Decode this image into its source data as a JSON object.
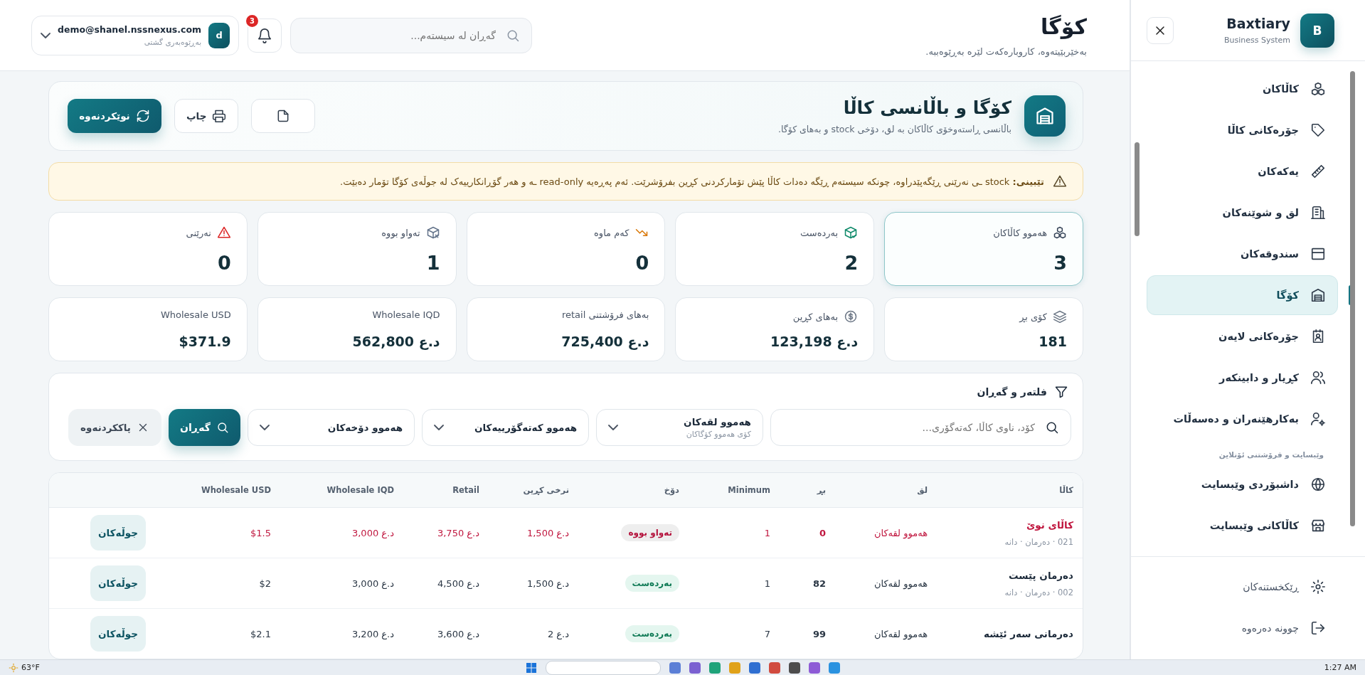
{
  "header": {
    "title": "کۆگا",
    "subtitle": "بەخێربێیتەوە، کاروبارەکەت لێرە بەڕێوەببە.",
    "search": {
      "placeholder": "گەڕان لە سیستەم..."
    },
    "notifications": {
      "count": "3"
    },
    "user": {
      "avatar": "d",
      "email": "demo@shanel.nssnexus.com",
      "role": "بەڕێوەبەری گشتی"
    }
  },
  "hero": {
    "title": "کۆگا و باڵانسی کاڵا",
    "description": "باڵانسی ڕاستەوخۆی کاڵاکان بە لق، دۆخی stock و بەهای کۆگا.",
    "buttons": [
      {
        "label": "چاپ",
        "kind": "print"
      },
      {
        "label": "نوێکردنەوە",
        "kind": "refresh"
      }
    ]
  },
  "alert": {
    "text": "**تێبینی:** stock ـی نەرێنی ڕێگەپێدراوە، چونکە سیستەم ڕێگە دەدات کاڵا پێش تۆمارکردنی کڕین بفرۆشرێت. ئەم پەڕەیە read-only ـە و هەر گۆڕانکارییەک لە جوڵەی کۆگا تۆمار دەبێت."
  },
  "stats": [
    {
      "label": "هەموو کاڵاکان",
      "value": "3",
      "kind": "all",
      "selected": true
    },
    {
      "label": "بەردەست",
      "value": "2",
      "kind": "available",
      "selected": false
    },
    {
      "label": "کەم ماوە",
      "value": "0",
      "kind": "low",
      "selected": false
    },
    {
      "label": "تەواو بووە",
      "value": "1",
      "kind": "out",
      "selected": false
    },
    {
      "label": "نەرێنی",
      "value": "0",
      "kind": "negative",
      "selected": false
    }
  ],
  "totals": [
    {
      "label": "کۆی بڕ",
      "value": "181",
      "kind": "quantity"
    },
    {
      "label": "بەهای کڕین",
      "value": "123,198 د.ع",
      "kind": "money"
    },
    {
      "label": "بەهای فرۆشتنی retail",
      "value": "725,400 د.ع",
      "kind": "plain"
    },
    {
      "label": "Wholesale IQD",
      "value": "562,800 د.ع",
      "kind": "plain"
    },
    {
      "label": "Wholesale USD",
      "value": "$371.9",
      "kind": "plain"
    }
  ],
  "filters": {
    "title": "فلتەر و گەڕان",
    "search": {
      "placeholder": "کۆد، ناوی کاڵا، کەتەگۆری..."
    },
    "selects": [
      {
        "value": "هەموو لقەکان",
        "hint": "کۆی هەموو کۆگاکان"
      },
      {
        "value": "هەموو کەتەگۆرییەکان"
      },
      {
        "value": "هەموو دۆخەکان"
      }
    ],
    "search_button": "گەڕان",
    "clear_button": "پاککردنەوە"
  },
  "table": {
    "columns": [
      "کاڵا",
      "لق",
      "بڕ",
      "Minimum",
      "دۆخ",
      "نرخی کڕین",
      "Retail",
      "Wholesale IQD",
      "Wholesale USD"
    ],
    "rows": [
      {
        "name": "کاڵای نوێ",
        "meta": "021 · دەرمان · دانە",
        "branch": "هەموو لقەکان",
        "qty": "0",
        "minimum": "1",
        "status": {
          "label": "تەواو بووە",
          "kind": "out"
        },
        "buy": "1,500 د.ع",
        "retail": "3,750 د.ع",
        "wholesale_iqd": "3,000 د.ع",
        "wholesale_usd": "$1.5",
        "action": "جوڵەکان"
      },
      {
        "name": "دەرمان پێست",
        "meta": "002 · دەرمان · دانە",
        "branch": "هەموو لقەکان",
        "qty": "82",
        "minimum": "1",
        "status": {
          "label": "بەردەست",
          "kind": "available"
        },
        "buy": "1,500 د.ع",
        "retail": "4,500 د.ع",
        "wholesale_iqd": "3,000 د.ع",
        "wholesale_usd": "$2",
        "action": "جوڵەکان"
      },
      {
        "name": "دەرمانی سەر ئێشە",
        "branch": "هەموو لقەکان",
        "qty": "99",
        "minimum": "7",
        "status": {
          "label": "بەردەست",
          "kind": "available"
        },
        "buy": "2 د.ع",
        "retail": "3,600 د.ع",
        "wholesale_iqd": "3,200 د.ع",
        "wholesale_usd": "$2.1",
        "action": "جوڵەکان"
      }
    ]
  },
  "sidebar": {
    "brand": "Baxtiary",
    "tagline": "Business System",
    "avatar": "B",
    "items": [
      {
        "label": "کاڵاکان",
        "selected": false
      },
      {
        "label": "جۆرەکانی کاڵا",
        "selected": false
      },
      {
        "label": "یەکەکان",
        "selected": false
      },
      {
        "label": "لق و شوێنەکان",
        "selected": false
      },
      {
        "label": "سندوقەکان",
        "selected": false
      },
      {
        "label": "کۆگا",
        "selected": true
      },
      {
        "label": "جۆرەکانی لایەن",
        "selected": false
      },
      {
        "label": "کڕیار و دابینکەر",
        "selected": false
      },
      {
        "label": "بەکارهێنەران و دەسەڵات",
        "selected": false
      }
    ],
    "section": {
      "title": "وێبسایت و فرۆشتنی ئۆنلاین",
      "items": [
        {
          "label": "داشبۆردی وێبسایت",
          "selected": false
        },
        {
          "label": "کاڵاکانی وێبسایت",
          "selected": false
        }
      ]
    },
    "footer": [
      {
        "label": "ڕێکخستنەکان"
      },
      {
        "label": "چوونە دەرەوە"
      }
    ]
  },
  "taskbar": {
    "weather": "63°F",
    "time": "1:27 AM"
  }
}
